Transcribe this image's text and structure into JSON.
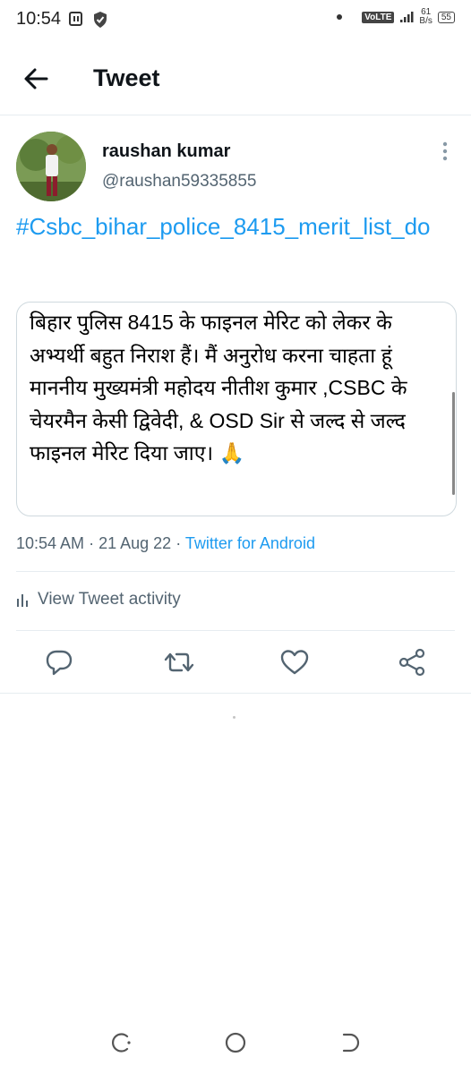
{
  "status_bar": {
    "time": "10:54",
    "volte": "VoLTE",
    "net_speed_value": "61",
    "net_speed_unit": "B/s",
    "battery": "55"
  },
  "header": {
    "title": "Tweet"
  },
  "tweet": {
    "author_name": "raushan kumar",
    "author_handle": "@raushan59335855",
    "hashtag": "#Csbc_bihar_police_8415_merit_list_do",
    "image_text": "बिहार पुलिस 8415 के फाइनल मेरिट को लेकर के अभ्यर्थी बहुत निराश हैं। मैं अनुरोध करना चाहता हूं  माननीय मुख्यमंत्री महोदय नीतीश कुमार ,CSBC के चेयरमैन केसी द्विवेदी, & OSD Sir से जल्द से जल्द फाइनल मेरिट दिया जाए। 🙏",
    "time": "10:54 AM",
    "sep1": "·",
    "date": "21 Aug 22",
    "sep2": "·",
    "source": "Twitter for Android"
  },
  "activity": {
    "label": "View Tweet activity"
  },
  "icons": {
    "back": "arrow-left-icon",
    "more": "more-vertical-icon",
    "reply": "reply-icon",
    "retweet": "retweet-icon",
    "like": "heart-icon",
    "share": "share-icon",
    "activity": "bar-chart-icon"
  },
  "colors": {
    "link": "#1d9bf0",
    "secondary_text": "#536471",
    "divider": "#e6ecf0",
    "border": "#cfd9de"
  }
}
